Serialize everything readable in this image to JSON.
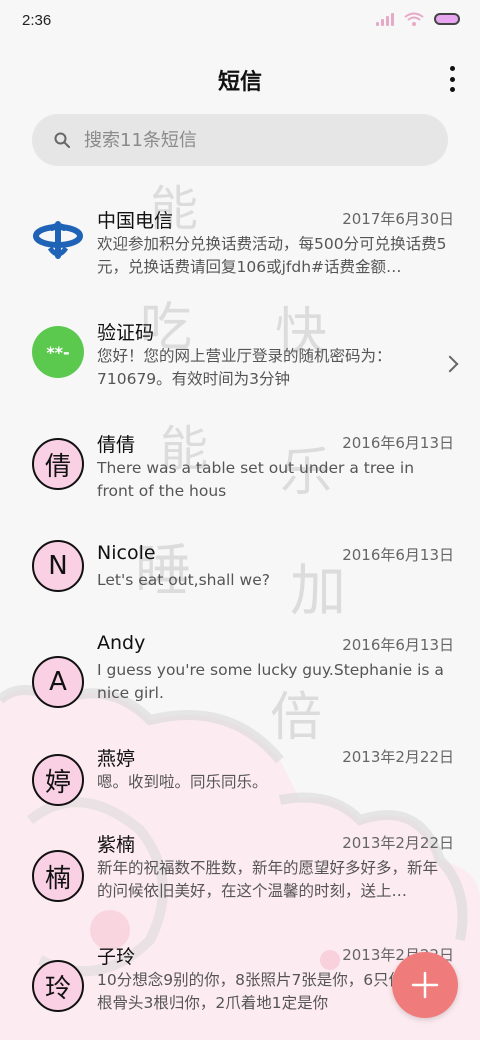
{
  "status": {
    "time": "2:36"
  },
  "header": {
    "title": "短信"
  },
  "search": {
    "placeholder": "搜索11条短信"
  },
  "threads": [
    {
      "name": "中国电信",
      "date": "2017年6月30日",
      "preview": "欢迎参加积分兑换话费活动，每500分可兑换话费5元，兑换话费请回复106或jfdh#话费金额…",
      "avatar_type": "logo",
      "avatar_icon": "china-telecom-logo-icon"
    },
    {
      "name": "验证码",
      "date": "",
      "preview": "您好！您的网上营业厅登录的随机密码为：710679。有效时间为3分钟",
      "avatar_type": "code",
      "avatar_text": "**-"
    },
    {
      "name": "倩倩",
      "date": "2016年6月13日",
      "preview": "There was a table set out under a tree in front of the hous",
      "avatar_type": "letter",
      "avatar_text": "倩"
    },
    {
      "name": "Nicole",
      "date": "2016年6月13日",
      "preview": "Let's eat out,shall we?",
      "avatar_type": "letter",
      "avatar_text": "N"
    },
    {
      "name": "Andy",
      "date": "2016年6月13日",
      "preview": "I guess you're some lucky guy.Stephanie is a nice girl.",
      "avatar_type": "letter",
      "avatar_text": "A"
    },
    {
      "name": "燕婷",
      "date": "2013年2月22日",
      "preview": "嗯。收到啦。同乐同乐。",
      "avatar_type": "letter",
      "avatar_text": "婷"
    },
    {
      "name": "紫楠",
      "date": "2013年2月22日",
      "preview": "新年的祝福数不胜数，新年的愿望好多好多，新年的问候依旧美好，在这个温馨的时刻，送上…",
      "avatar_type": "letter",
      "avatar_text": "楠"
    },
    {
      "name": "子玲",
      "date": "2013年2月22日",
      "preview": "10分想念9别的你，8张照片7张是你，6只像你，4根骨头3根归你，2爪着地1定是你",
      "avatar_type": "letter",
      "avatar_text": "玲"
    }
  ],
  "watermark": {
    "text": [
      "能",
      "吃",
      "快",
      "能",
      "乐",
      "睡",
      "加",
      "倍"
    ]
  },
  "colors": {
    "avatar_bg": "#fad0e4",
    "fab": "#f07b7b",
    "code_avatar": "#5ac94e",
    "telecom_blue": "#1f63b6"
  },
  "fab": {
    "icon": "plus-icon"
  }
}
